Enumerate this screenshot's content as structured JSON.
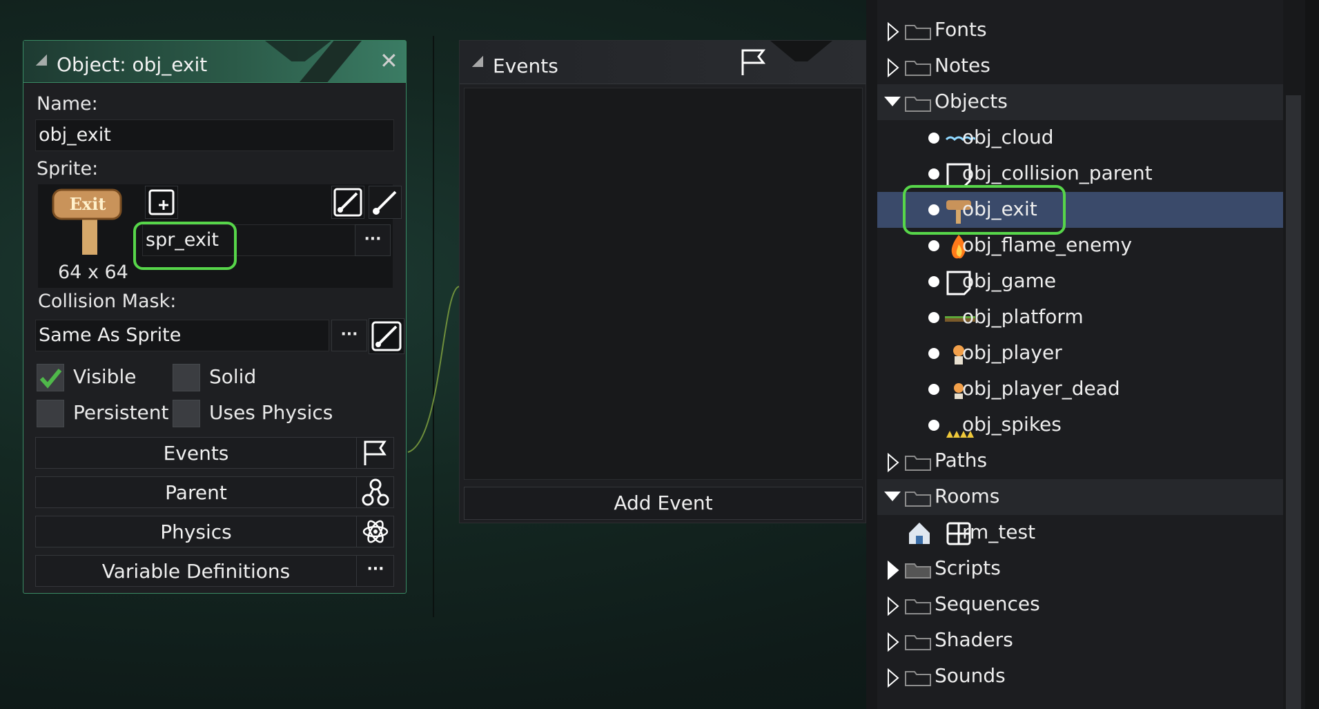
{
  "object_window": {
    "title": "Object: obj_exit",
    "name_label": "Name:",
    "name_value": "obj_exit",
    "sprite_label": "Sprite:",
    "sprite_name": "spr_exit",
    "sprite_size": "64 x 64",
    "sprite_thumb_text": "Exit",
    "collision_mask_label": "Collision Mask:",
    "collision_mask_value": "Same As Sprite",
    "dots": "···",
    "checkboxes": [
      {
        "label": "Visible",
        "checked": true
      },
      {
        "label": "Solid",
        "checked": false
      },
      {
        "label": "Persistent",
        "checked": false
      },
      {
        "label": "Uses Physics",
        "checked": false
      }
    ],
    "buttons": [
      {
        "label": "Events",
        "icon": "flag-icon"
      },
      {
        "label": "Parent",
        "icon": "hierarchy-icon"
      },
      {
        "label": "Physics",
        "icon": "physics-atom-icon"
      },
      {
        "label": "Variable Definitions",
        "icon": "more-dots-icon"
      }
    ],
    "close_glyph": "✕",
    "accent_color": "#3a8a64",
    "highlight_color": "#57d64a"
  },
  "events_window": {
    "title": "Events",
    "add_event_label": "Add Event"
  },
  "asset_browser": {
    "items": [
      {
        "label": "Fonts",
        "type": "folder",
        "expanded": false
      },
      {
        "label": "Notes",
        "type": "folder",
        "expanded": false
      },
      {
        "label": "Objects",
        "type": "folder",
        "expanded": true
      },
      {
        "label": "obj_cloud",
        "type": "object"
      },
      {
        "label": "obj_collision_parent",
        "type": "object"
      },
      {
        "label": "obj_exit",
        "type": "object",
        "selected": true
      },
      {
        "label": "obj_flame_enemy",
        "type": "object"
      },
      {
        "label": "obj_game",
        "type": "object"
      },
      {
        "label": "obj_platform",
        "type": "object"
      },
      {
        "label": "obj_player",
        "type": "object"
      },
      {
        "label": "obj_player_dead",
        "type": "object"
      },
      {
        "label": "obj_spikes",
        "type": "object"
      },
      {
        "label": "Paths",
        "type": "folder",
        "expanded": false
      },
      {
        "label": "Rooms",
        "type": "folder",
        "expanded": true
      },
      {
        "label": "rm_test",
        "type": "room"
      },
      {
        "label": "Scripts",
        "type": "folder",
        "expanded": false
      },
      {
        "label": "Sequences",
        "type": "folder",
        "expanded": false
      },
      {
        "label": "Shaders",
        "type": "folder",
        "expanded": false
      },
      {
        "label": "Sounds",
        "type": "folder",
        "expanded": false
      }
    ],
    "selection_color": "#3a4a6a"
  }
}
